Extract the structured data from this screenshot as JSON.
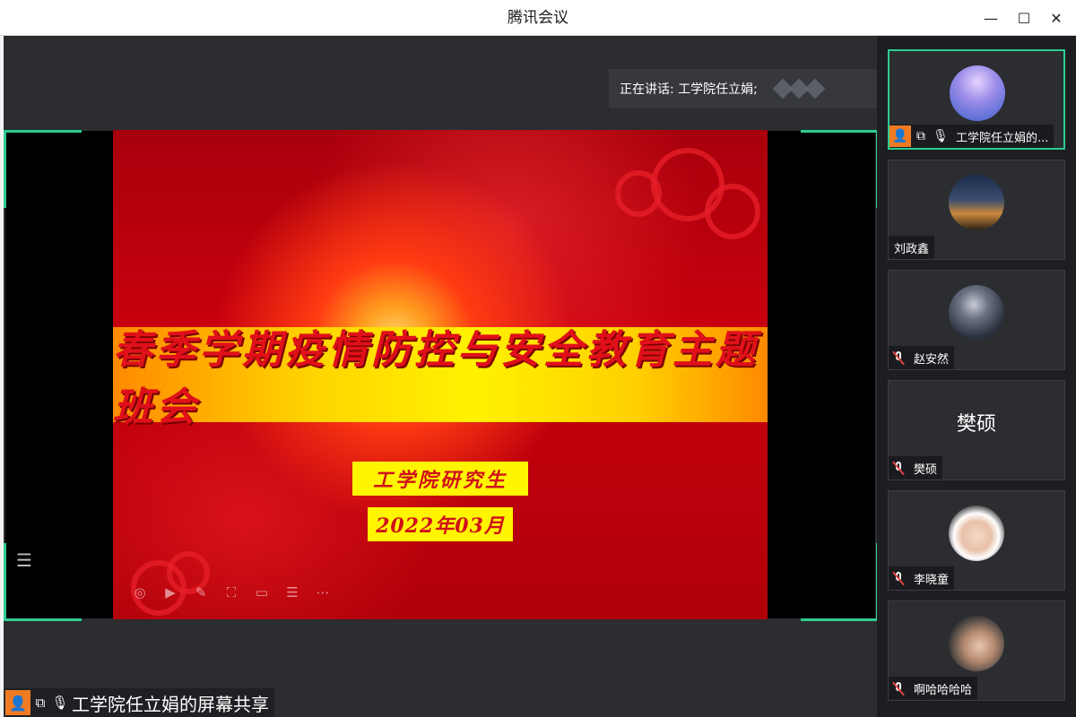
{
  "window": {
    "title": "腾讯会议",
    "controls": [
      "minimize-icon",
      "maximize-icon",
      "close-icon"
    ]
  },
  "speaking": {
    "text": "正在讲话: 工学院任立娟;"
  },
  "slide": {
    "title": "春季学期疫情防控与安全教育主题班会",
    "subtitle": "工学院研究生",
    "date": "2022年03月"
  },
  "share_toolbar": [
    "voice-icon",
    "play-icon",
    "pen-icon",
    "screenshot-icon",
    "camera-icon",
    "chat-icon",
    "more-icon"
  ],
  "share_caption": {
    "text": "工学院任立娟的屏幕共享"
  },
  "participants": [
    {
      "name": "工学院任立娟的...",
      "role": "host",
      "mic": "on",
      "sharing": true,
      "avatar": "purple-sky"
    },
    {
      "name": "刘政鑫",
      "mic": "none",
      "avatar": "city-night"
    },
    {
      "name": "赵安然",
      "mic": "muted",
      "avatar": "figure"
    },
    {
      "name": "樊硕",
      "mic": "muted",
      "avatar": "text",
      "avatar_text": "樊硕"
    },
    {
      "name": "李晓童",
      "mic": "muted",
      "avatar": "child"
    },
    {
      "name": "啊哈哈哈哈",
      "mic": "muted",
      "avatar": "child2"
    }
  ],
  "colors": {
    "accent": "#2ecc8f",
    "host_badge": "#f07b23",
    "muted": "#e64545"
  }
}
